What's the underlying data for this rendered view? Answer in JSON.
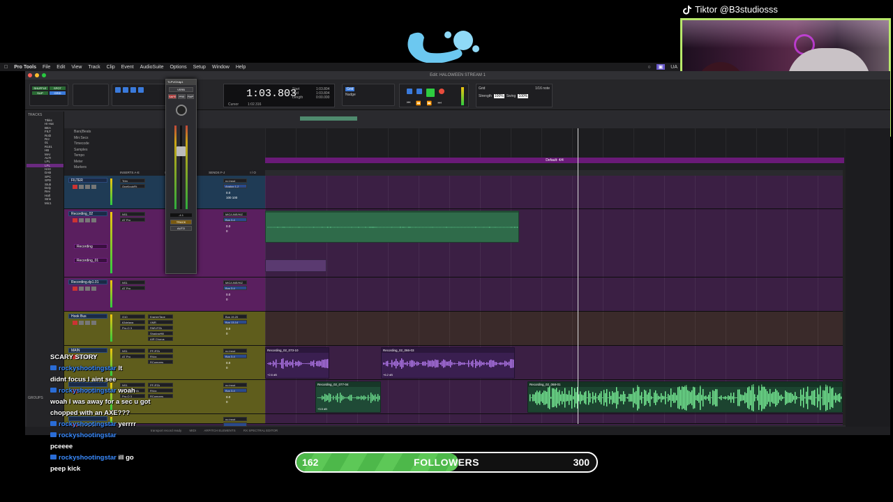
{
  "overlay": {
    "tiktok_handle": "Tiktor @B3studiosss",
    "tiktok_icon": "tiktok-icon",
    "follower_goal": {
      "current": "162",
      "label": "FOLLOWERS",
      "goal": "300",
      "progress_fraction": 0.54
    },
    "chat": [
      {
        "user": "",
        "text": "SCARY STORY"
      },
      {
        "user": "rockyshootingstar",
        "text": "lt"
      },
      {
        "user": "",
        "text": "didnt focus I aint see"
      },
      {
        "user": "rockyshootingstar",
        "text": "woah"
      },
      {
        "user": "",
        "text": "woah I was away for a sec u got chopped with an AXE???"
      },
      {
        "user": "rockyshootingstar",
        "text": "yerrrr"
      },
      {
        "user": "rockyshootingstar",
        "text": ""
      },
      {
        "user": "",
        "text": "pceeee"
      },
      {
        "user": "rockyshootingstar",
        "text": "ill go"
      },
      {
        "user": "",
        "text": "peep kick"
      }
    ]
  },
  "menubar": {
    "app": "Pro Tools",
    "items": [
      "File",
      "Edit",
      "View",
      "Track",
      "Clip",
      "Event",
      "AudioSuite",
      "Options",
      "Setup",
      "Window",
      "Help"
    ],
    "right": [
      "UA"
    ]
  },
  "window": {
    "title": "Edit: HALOWEEN STREAM 1"
  },
  "toolbar": {
    "counter_main": "1:03.803",
    "cursor_label": "Cursor",
    "cursor_value": "1:02.316",
    "start_label": "Start",
    "start_value": "1:03.804",
    "end_label": "End",
    "end_value": "1:03.804",
    "length_label": "Length",
    "length_value": "0:00.000",
    "grid_label": "Grid",
    "grid_value": "1/16 note",
    "nudge_label": "Nudge",
    "strength_label": "Strength",
    "strength_value": "100%",
    "swing_label": "Swing",
    "swing_value": "100%",
    "mode_buttons": [
      "SHUFFLE",
      "SPOT",
      "SLIP",
      "GRID"
    ]
  },
  "tracks_panel": {
    "header": "TRACKS",
    "groups_header": "GROUPS",
    "items": [
      "TIkks",
      "Hi-Hat",
      "BEA",
      "FILT",
      "Rol2",
      "Rcr",
      "01",
      "R101",
      "HB",
      "MAI",
      "ALTI",
      "LPL",
      "LPL",
      "HAII",
      "DAB",
      "SPC",
      "SPD",
      "Stub",
      "Dely",
      "Rev",
      "Hall",
      "Strin",
      "Mic1"
    ]
  },
  "rulers": [
    "Bars|Beats",
    "Min:Secs",
    "Timecode",
    "Samples",
    "Tempo",
    "Meter",
    "Markers"
  ],
  "marker_label": "Default: 4/4",
  "column_headers": {
    "inserts_ae": "INSERTS A-E",
    "inserts_fj": "INSERTS F-J",
    "sends": "SENDS F-J",
    "io": "I / O"
  },
  "tracks": [
    {
      "name": "FILTER",
      "inserts": [
        "Trim",
        "OneKnobFlt"
      ],
      "io_in": "no input",
      "io_out": "Analog 1-2",
      "vol": "0.0",
      "pan": "100 100",
      "color": "#1f3b55"
    },
    {
      "name": "Recording_02",
      "inserts": [
        "NS1",
        "AT Pro"
      ],
      "io_in": "MIC/LINE/HIZ",
      "io_out": "Bus 3-4",
      "vol": "0.0",
      "pan": "0",
      "color": "#5a1f5f",
      "sub": [
        "Recording",
        "Recording_01"
      ]
    },
    {
      "name": "Recording.dp1.01",
      "inserts": [
        "NS1",
        "AT Pro"
      ],
      "io_in": "MIC/LINE/HIZ",
      "io_out": "Bus 3-4",
      "vol": "0.0",
      "pan": "0",
      "color": "#5a1f5f"
    },
    {
      "name": "Hook Bus",
      "inserts": [
        "Q10",
        "63delaya",
        "Pro-Q 3"
      ],
      "inserts2": [
        "KramerTape",
        "VMR",
        "PAR-RTA",
        "ShadowHill",
        "AIR Chorus"
      ],
      "io_in": "Bus 19-20",
      "io_out": "Bus 13-14",
      "vol": "0.0",
      "pan": "0",
      "color": "#5f5d1c"
    },
    {
      "name": "MAIN",
      "inserts": [
        "NS1",
        "AT Pro"
      ],
      "inserts2": [
        "PF-RTA",
        "RVox",
        "RCompres"
      ],
      "io_in": "no input",
      "io_out": "Bus 3-4",
      "vol": "0.0",
      "pan": "0",
      "color": "#5f5d1c"
    },
    {
      "name": "",
      "inserts": [
        "NS1",
        "PgTrk1DPHA",
        "Pro-Q 3"
      ],
      "inserts2": [
        "PF-RTA",
        "RVox",
        "RCompres"
      ],
      "io_in": "no input",
      "io_out": "Bus 3-4",
      "vol": "0.0",
      "pan": "0",
      "color": "#5f5d1c"
    },
    {
      "name": "",
      "inserts": [],
      "io_in": "no input",
      "io_out": "",
      "vol": "",
      "pan": "",
      "color": "#5f5d1c"
    }
  ],
  "clips": [
    {
      "label": "",
      "row": 1
    },
    {
      "label": "Recording_02_073-10",
      "row": 4,
      "db": "+2.6 dB"
    },
    {
      "label": "Recording_02_066-03",
      "row": 4,
      "db": "+6.2 dB"
    },
    {
      "label": "Recording_02_077-04",
      "row": 5,
      "db": "+3.5 dB"
    },
    {
      "label": "Recording_02_068-01",
      "row": 5,
      "db": ""
    }
  ],
  "mixer_strip": {
    "title": "TLPVOXdp1",
    "plugin": "VERB",
    "vol": "-4.1",
    "track_label": "TRACK",
    "auto": "AUTO",
    "safe": "SAFE",
    "pre": "PRE",
    "fmp": "FMP"
  },
  "status_bar": {
    "left": "transport record ready",
    "tabs": [
      "MIDI",
      "ARPITCH ELEMENTS",
      "RX SPECTRAL EDITOR"
    ]
  },
  "colors": {
    "accent": "#3a7adb",
    "green_clip": "#62d87a",
    "purple_clip": "#a070e0",
    "follower_fill": "#4db84a"
  }
}
